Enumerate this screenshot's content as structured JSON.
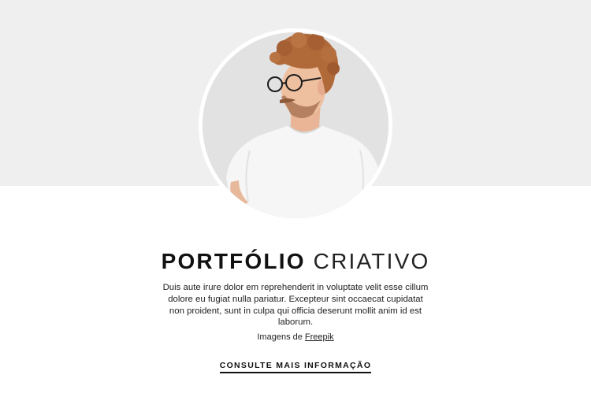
{
  "hero": {
    "image_alt": "Man with curly hair and glasses wearing a white t-shirt"
  },
  "headline": {
    "bold_text": "PORTFÓLIO",
    "light_text": "CRIATIVO"
  },
  "description": "Duis aute irure dolor em reprehenderit in voluptate velit esse cillum dolore eu fugiat nulla pariatur. Excepteur sint occaecat cupidatat non proident, sunt in culpa qui officia deserunt mollit anim id est laborum.",
  "credit": {
    "prefix": "Imagens de",
    "link_label": "Freepik"
  },
  "cta": {
    "label": "CONSULTE MAIS INFORMAÇÃO"
  },
  "colors": {
    "top_band": "#efefef",
    "text": "#111111",
    "page_bg": "#ffffff"
  }
}
